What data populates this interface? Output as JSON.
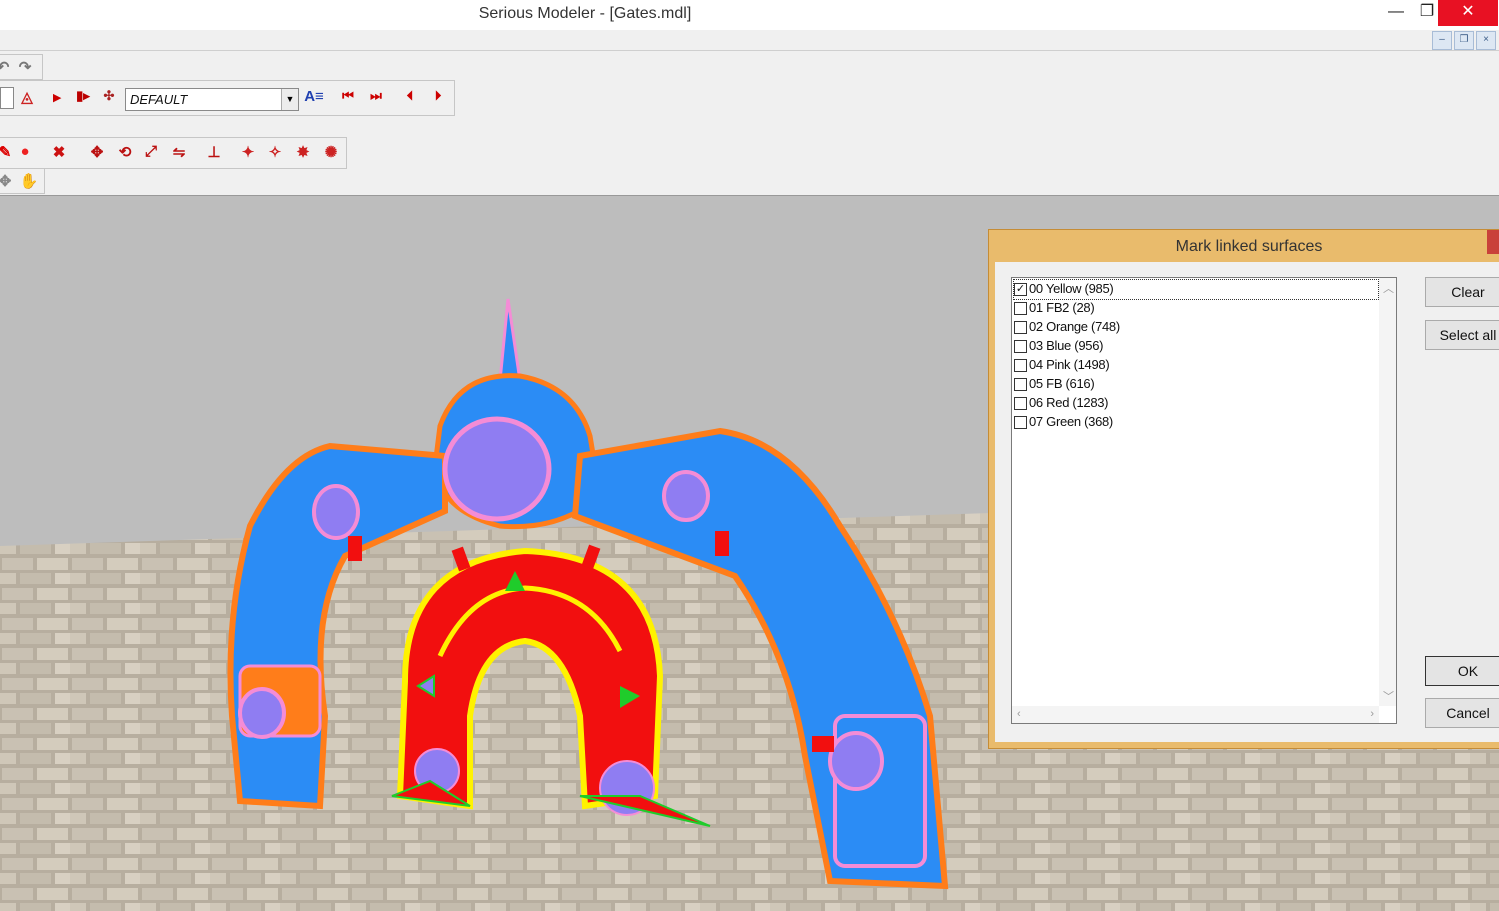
{
  "window": {
    "title": "Serious Modeler - [Gates.mdl]",
    "minimize_glyph": "—",
    "restore_glyph": "❐",
    "close_glyph": "✕"
  },
  "mdi": {
    "minimize_glyph": "–",
    "restore_glyph": "❐",
    "close_glyph": "×"
  },
  "toolbar": {
    "animation_combo_value": "DEFAULT",
    "icons": [
      "undo-icon",
      "redo-icon",
      "animation-icon",
      "play-icon",
      "play-selection-icon",
      "frame-settings-icon",
      "rename-animation-icon",
      "first-frame-icon",
      "last-frame-icon",
      "prev-frame-icon",
      "next-frame-icon",
      "surface-color-icon",
      "color-palette-icon",
      "delete-icon",
      "mapping-icons",
      "light-icons"
    ]
  },
  "dialog": {
    "title": "Mark linked surfaces",
    "surfaces": [
      {
        "label": "00 Yellow (985)",
        "checked": true
      },
      {
        "label": "01 FB2 (28)",
        "checked": false
      },
      {
        "label": "02 Orange (748)",
        "checked": false
      },
      {
        "label": "03 Blue (956)",
        "checked": false
      },
      {
        "label": "04 Pink (1498)",
        "checked": false
      },
      {
        "label": "05 FB (616)",
        "checked": false
      },
      {
        "label": "06 Red (1283)",
        "checked": false
      },
      {
        "label": "07 Green (368)",
        "checked": false
      }
    ],
    "buttons": {
      "clear": "Clear",
      "select_all": "Select all",
      "ok": "OK",
      "cancel": "Cancel"
    }
  },
  "colors": {
    "model_blue": "#2b8cf5",
    "model_orange": "#ff7d1a",
    "model_pink": "#f48cd6",
    "model_violet": "#8f7df2",
    "model_red": "#f20f0f",
    "model_yellow": "#fff200",
    "model_green": "#1fcc2b",
    "sky": "#bdbdbd",
    "floor": "#b4ab9d",
    "dialog_frame": "#e9bb6c"
  }
}
